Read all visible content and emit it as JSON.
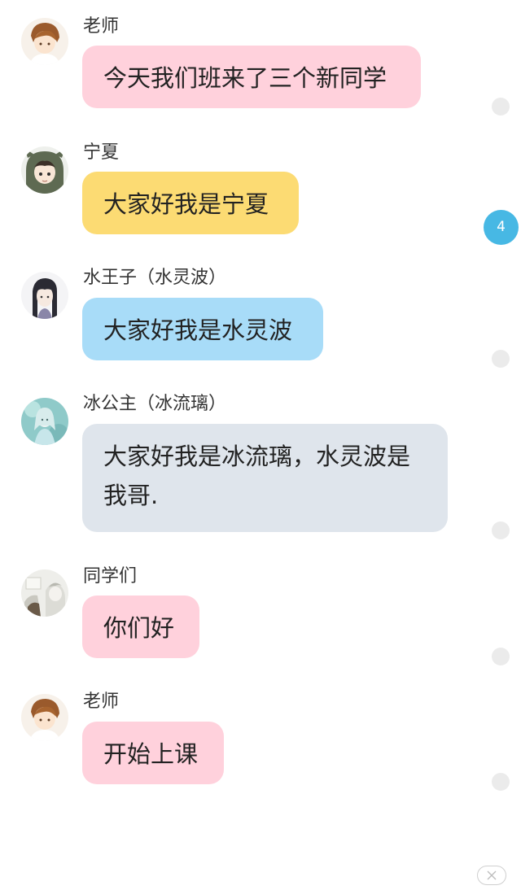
{
  "colors": {
    "pink": "#ffd1dc",
    "yellow": "#fcdb73",
    "blue": "#a8dcf8",
    "gray": "#dfe5ec",
    "badge": "#47b8e4"
  },
  "messages": [
    {
      "sender": "老师",
      "text": "今天我们班来了三个新同学",
      "bubble_color": "#ffd1dc",
      "avatar": "teacher-avatar"
    },
    {
      "sender": "宁夏",
      "text": "大家好我是宁夏",
      "bubble_color": "#fcdb73",
      "avatar": "ningxia-avatar"
    },
    {
      "sender": "水王子（水灵波）",
      "text": "大家好我是水灵波",
      "bubble_color": "#a8dcf8",
      "avatar": "water-prince-avatar"
    },
    {
      "sender": "冰公主（冰流璃）",
      "text": "大家好我是冰流璃，水灵波是我哥.",
      "bubble_color": "#dfe5ec",
      "avatar": "ice-princess-avatar"
    },
    {
      "sender": "同学们",
      "text": "你们好",
      "bubble_color": "#ffd1dc",
      "avatar": "classmates-avatar"
    },
    {
      "sender": "老师",
      "text": "开始上课",
      "bubble_color": "#ffd1dc",
      "avatar": "teacher-avatar"
    }
  ],
  "unread_badge": "4"
}
